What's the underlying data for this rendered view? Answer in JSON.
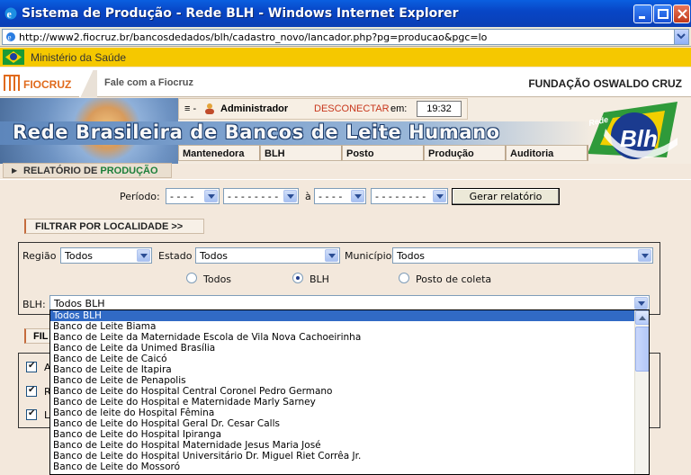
{
  "window": {
    "title": "Sistema de Produção - Rede BLH - Windows Internet Explorer",
    "url": "http://www2.fiocruz.br/bancosdedados/blh/cadastro_novo/lancador.php?pg=producao&pgc=lo"
  },
  "gov_bar": {
    "label": "Ministério da Saúde"
  },
  "fiocruz_bar": {
    "logo_text": "FIOCRUZ",
    "fale": "Fale com a Fiocruz",
    "fundacao": "FUNDAÇÃO OSWALDO CRUZ"
  },
  "header": {
    "menu_glyph": "≡ -",
    "user": "Administrador",
    "logout": "DESCONECTAR",
    "em_label": "em:",
    "clock": "19:32",
    "banner_title": "Rede Brasileira de Bancos de Leite Humano",
    "logo_rede": "Rede",
    "logo_blh": "Blh"
  },
  "nav": {
    "items": [
      "Mantenedora",
      "BLH",
      "Posto",
      "Produção",
      "Auditoria"
    ]
  },
  "report_header": {
    "prefix": "RELATÓRIO DE",
    "highlight": "PRODUÇÃO"
  },
  "period": {
    "label": "Período:",
    "start_month": "- - - -",
    "start_year": "- - - - - - - -",
    "a_label": "à",
    "end_month": "- - - -",
    "end_year": "- - - - - - - -",
    "generate_button": "Gerar relatório"
  },
  "filter": {
    "toggle_label": "FILTRAR POR LOCALIDADE >>",
    "regiao_label": "Região",
    "regiao_value": "Todos",
    "estado_label": "Estado",
    "estado_value": "Todos",
    "municipio_label": "Município",
    "municipio_value": "Todos",
    "radios": [
      {
        "label": "Todos",
        "checked": false
      },
      {
        "label": "BLH",
        "checked": true
      },
      {
        "label": "Posto de coleta",
        "checked": false
      }
    ],
    "blh_label": "BLH:",
    "blh_value": "Todos BLH"
  },
  "second_filter": {
    "toggle_label": "FIL",
    "checkboxes": [
      "A",
      "R",
      "L"
    ]
  },
  "blh_options": [
    "Todos BLH",
    "Banco de Leite Biama",
    "Banco de Leite da Maternidade Escola de Vila Nova Cachoeirinha",
    "Banco de Leite da Unimed Brasília",
    "Banco de Leite de Caicó",
    "Banco de Leite de Itapira",
    "Banco de Leite de Penapolis",
    "Banco de Leite do Hospital Central Coronel Pedro Germano",
    "Banco de Leite do Hospital e Maternidade Marly Sarney",
    "Banco de leite do Hospital Fêmina",
    "Banco de Leite do Hospital Geral Dr. Cesar Calls",
    "Banco de Leite do Hospital Ipiranga",
    "Banco de Leite do Hospital Maternidade Jesus Maria José",
    "Banco de Leite do Hospital Universitário Dr. Miguel Riet Corrêa Jr.",
    "Banco de Leite do Mossoró"
  ],
  "colors": {
    "titlebar": "#0a5fe0",
    "gov": "#f5c800",
    "fiocruz": "#e06a1c",
    "selection": "#316ac5"
  }
}
